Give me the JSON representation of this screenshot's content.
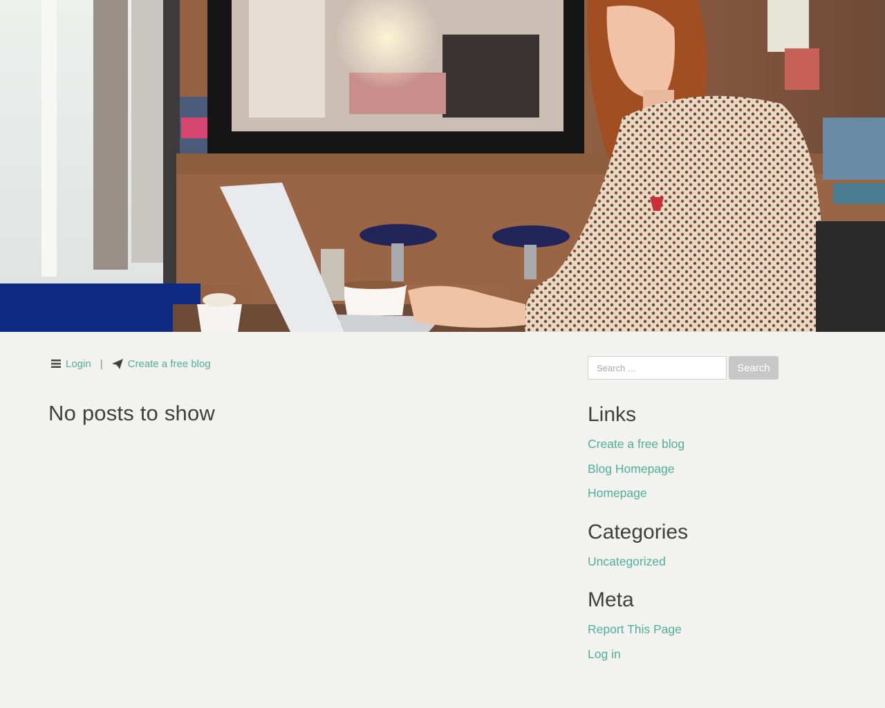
{
  "hero": {
    "image": "woman-using-laptop-in-cafe-photo"
  },
  "nav": {
    "menu_icon": "menu-icon",
    "login_label": "Login",
    "separator": "|",
    "create_icon": "paper-plane-icon",
    "create_label": "Create a free blog"
  },
  "main": {
    "heading": "No posts to show"
  },
  "sidebar": {
    "search": {
      "placeholder": "Search …",
      "button_label": "Search"
    },
    "links": {
      "title": "Links",
      "items": [
        "Create a free blog",
        "Blog Homepage",
        "Homepage"
      ]
    },
    "categories": {
      "title": "Categories",
      "items": [
        "Uncategorized"
      ]
    },
    "meta": {
      "title": "Meta",
      "items": [
        "Report This Page",
        "Log in"
      ]
    }
  },
  "colors": {
    "background": "#f2f2f1",
    "link": "#4fb095",
    "heading": "#3f3f3f",
    "search_button": "#c7c7c7"
  }
}
